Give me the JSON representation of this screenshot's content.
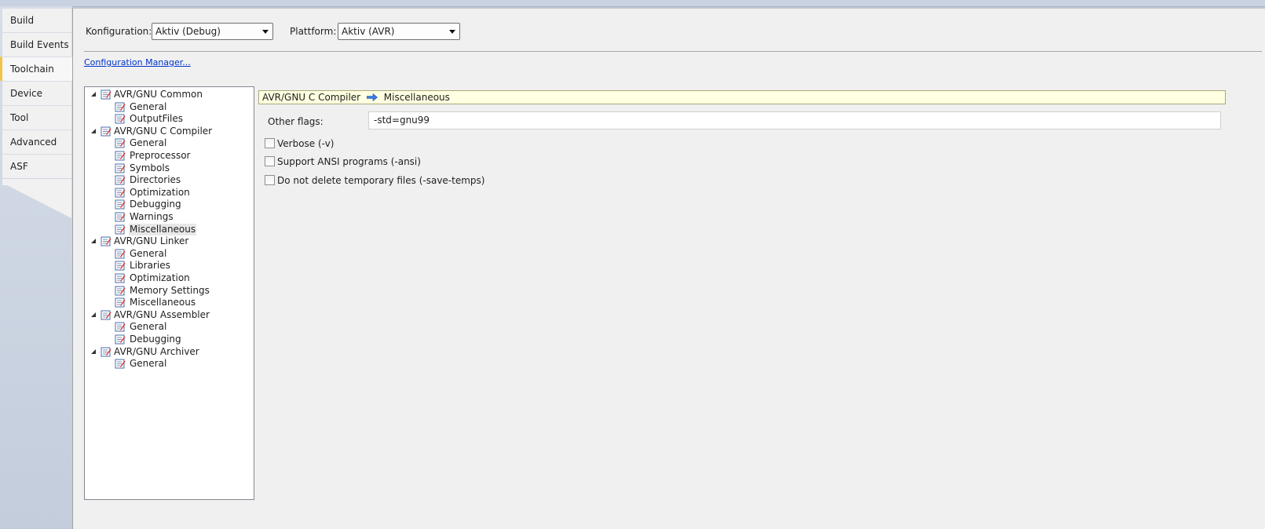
{
  "tabs": [
    {
      "label": "Build",
      "active": false
    },
    {
      "label": "Build Events",
      "active": false
    },
    {
      "label": "Toolchain",
      "active": true
    },
    {
      "label": "Device",
      "active": false
    },
    {
      "label": "Tool",
      "active": false
    },
    {
      "label": "Advanced",
      "active": false
    },
    {
      "label": "ASF",
      "active": false
    }
  ],
  "config": {
    "konfiguration_label": "Konfiguration:",
    "konfiguration_value": "Aktiv (Debug)",
    "plattform_label": "Plattform:",
    "plattform_value": "Aktiv (AVR)",
    "config_manager_link": "Configuration Manager..."
  },
  "tree": [
    {
      "label": "AVR/GNU Common",
      "children": [
        "General",
        "OutputFiles"
      ]
    },
    {
      "label": "AVR/GNU C Compiler",
      "children": [
        "General",
        "Preprocessor",
        "Symbols",
        "Directories",
        "Optimization",
        "Debugging",
        "Warnings",
        "Miscellaneous"
      ]
    },
    {
      "label": "AVR/GNU Linker",
      "children": [
        "General",
        "Libraries",
        "Optimization",
        "Memory Settings",
        "Miscellaneous"
      ]
    },
    {
      "label": "AVR/GNU Assembler",
      "children": [
        "General",
        "Debugging"
      ]
    },
    {
      "label": "AVR/GNU Archiver",
      "children": [
        "General"
      ]
    }
  ],
  "selected_node": "AVR/GNU C Compiler/Miscellaneous",
  "breadcrumb": {
    "parent": "AVR/GNU C Compiler",
    "child": "Miscellaneous"
  },
  "other_flags": {
    "label": "Other flags:",
    "value": "-std=gnu99"
  },
  "checkboxes": [
    {
      "label": "Verbose (-v)",
      "checked": false
    },
    {
      "label": "Support ANSI programs (-ansi)",
      "checked": false
    },
    {
      "label": "Do not delete temporary files (-save-temps)",
      "checked": false
    }
  ],
  "colors": {
    "active_tab_accent": "#f5c34a",
    "breadcrumb_bg": "#ffffe1",
    "link": "#0033cc",
    "arrow_icon": "#3a7de0"
  },
  "icons": {
    "page": "property-page-icon",
    "expander": "tree-expander-icon",
    "breadcrumb_arrow": "right-arrow-icon"
  }
}
